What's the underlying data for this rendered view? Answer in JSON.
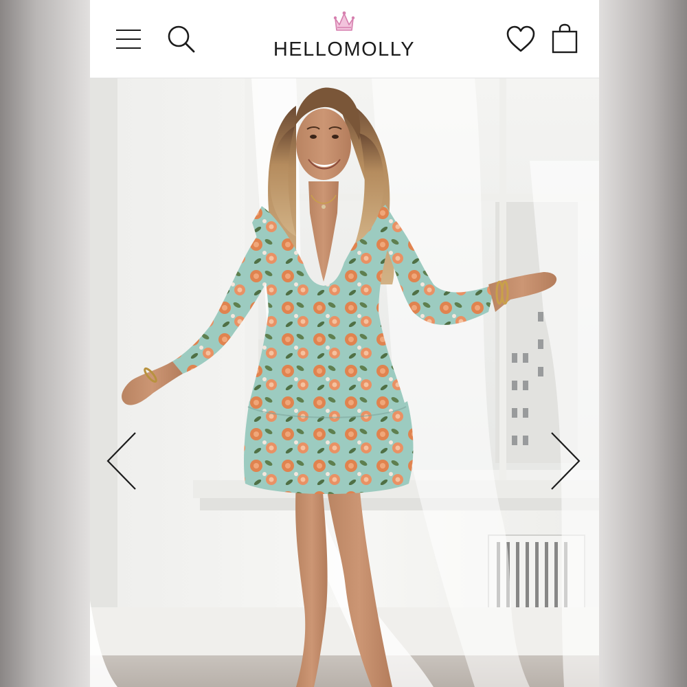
{
  "brand": {
    "name": "HELLOMOLLY"
  },
  "header": {
    "menu_icon": "hamburger-menu-icon",
    "search_icon": "search-icon",
    "logo_icon": "crown-icon",
    "wishlist_icon": "heart-icon",
    "cart_icon": "shopping-bag-icon"
  },
  "gallery": {
    "prev_icon": "chevron-left-icon",
    "next_icon": "chevron-right-icon"
  },
  "colors": {
    "accent_crown": "#e8a0c8",
    "dress_base": "#9ccbc0",
    "flower_orange": "#e0834f",
    "icon_stroke": "#1b1b1b"
  }
}
